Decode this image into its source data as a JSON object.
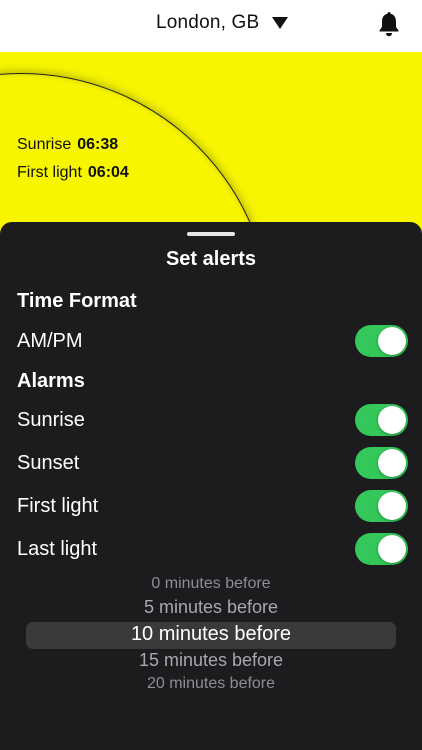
{
  "header": {
    "location": "London, GB"
  },
  "sun": {
    "sunrise_label": "Sunrise",
    "sunrise_time": "06:38",
    "first_light_label": "First light",
    "first_light_time": "06:04"
  },
  "sheet": {
    "title": "Set alerts",
    "time_format": {
      "heading": "Time Format",
      "ampm_label": "AM/PM",
      "ampm_on": true
    },
    "alarms": {
      "heading": "Alarms",
      "items": [
        {
          "label": "Sunrise",
          "on": true
        },
        {
          "label": "Sunset",
          "on": true
        },
        {
          "label": "First light",
          "on": true
        },
        {
          "label": "Last light",
          "on": true
        }
      ]
    },
    "picker": {
      "options": [
        "0 minutes before",
        "5 minutes before",
        "10 minutes before",
        "15 minutes before",
        "20 minutes before"
      ],
      "selected": "10 minutes before"
    }
  },
  "colors": {
    "sun_yellow": "#f7f500",
    "sheet_bg": "#1c1c1e",
    "toggle_on": "#34c759"
  },
  "icons": {
    "caret": "chevron-down-icon",
    "bell": "bell-icon"
  }
}
